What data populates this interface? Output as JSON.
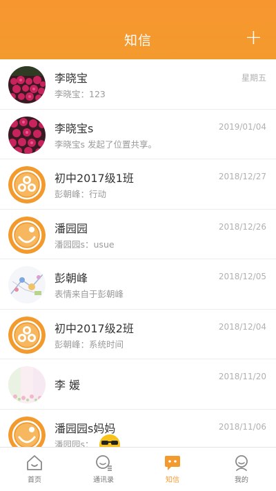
{
  "header": {
    "title": "知信",
    "add_icon": "plus-icon"
  },
  "conversations": [
    {
      "name": "李晓宝",
      "preview": "李晓宝：123",
      "time": "星期五",
      "avatar": "flower-photo"
    },
    {
      "name": "李晓宝s",
      "preview": "李晓宝s 发起了位置共享。",
      "time": "2019/01/04",
      "avatar": "flower-photo"
    },
    {
      "name": "初中2017级1班",
      "preview": "彭朝峰：行动",
      "time": "2018/12/27",
      "avatar": "group-icon"
    },
    {
      "name": "潘园园",
      "preview": "潘园园s：usue",
      "time": "2018/12/26",
      "avatar": "smile-icon"
    },
    {
      "name": "彭朝峰",
      "preview": "表情来自于彭朝峰",
      "time": "2018/12/05",
      "avatar": "sketch-photo"
    },
    {
      "name": "初中2017级2班",
      "preview": "彭朝峰：系统时间",
      "time": "2018/12/04",
      "avatar": "group-icon"
    },
    {
      "name": "李  媛",
      "preview": "",
      "time": "2018/11/20",
      "avatar": "pastel-photo"
    },
    {
      "name": "潘园园s妈妈",
      "preview": "潘园园s：",
      "time": "2018/11/06",
      "avatar": "smile-icon"
    }
  ],
  "tabs": [
    {
      "label": "首页",
      "icon": "home-icon"
    },
    {
      "label": "通讯录",
      "icon": "contacts-icon"
    },
    {
      "label": "知信",
      "icon": "chat-icon"
    },
    {
      "label": "我的",
      "icon": "profile-icon"
    }
  ],
  "colors": {
    "accent": "#f39a2e",
    "header": "#f7962f"
  }
}
